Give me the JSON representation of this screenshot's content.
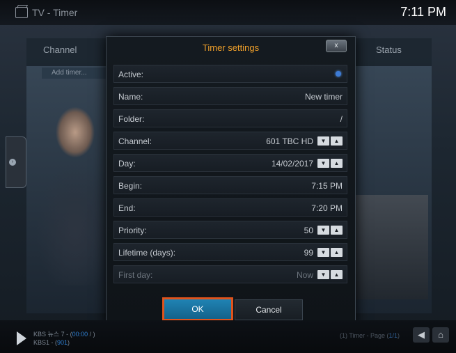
{
  "header": {
    "title": "TV - Timer",
    "clock": "7:11 PM"
  },
  "background": {
    "columns": {
      "channel": "Channel",
      "status": "Status"
    },
    "add_timer": "Add timer..."
  },
  "dialog": {
    "title": "Timer settings",
    "close_label": "x",
    "fields": [
      {
        "label": "Active:",
        "value": "",
        "control": "radio"
      },
      {
        "label": "Name:",
        "value": "New timer",
        "control": "none"
      },
      {
        "label": "Folder:",
        "value": "/",
        "control": "none"
      },
      {
        "label": "Channel:",
        "value": "601 TBC HD",
        "control": "spin"
      },
      {
        "label": "Day:",
        "value": "14/02/2017",
        "control": "spin"
      },
      {
        "label": "Begin:",
        "value": "7:15 PM",
        "control": "none"
      },
      {
        "label": "End:",
        "value": "7:20 PM",
        "control": "none"
      },
      {
        "label": "Priority:",
        "value": "50",
        "control": "spin"
      },
      {
        "label": "Lifetime (days):",
        "value": "99",
        "control": "spin"
      },
      {
        "label": "First day:",
        "value": "Now",
        "control": "spin",
        "disabled": true
      }
    ],
    "spin_down": "▼",
    "spin_up": "▲",
    "ok_label": "OK",
    "cancel_label": "Cancel"
  },
  "footer": {
    "now_playing": {
      "line1_prefix": "KBS 뉴스 7 - (",
      "line1_time": "00:00",
      "line1_suffix": " / )",
      "line2_prefix": "KBS1 - (",
      "line2_num": "901",
      "line2_suffix": ")"
    },
    "page_info_prefix": "(1) Timer - Page (",
    "page_info_page": "1/1",
    "page_info_suffix": ")"
  },
  "colors": {
    "accent": "#f0a02a",
    "focus": "#1f83b4",
    "highlight_border": "#e0531c"
  },
  "icons": {
    "app": "tv-icon",
    "play": "play-icon",
    "back": "back-arrow-icon",
    "home": "home-icon"
  }
}
